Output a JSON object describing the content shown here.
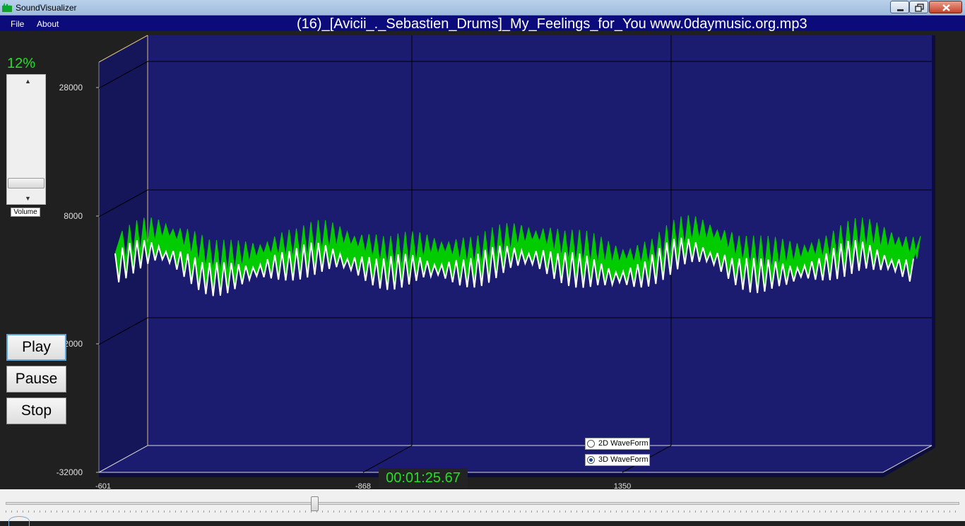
{
  "window": {
    "title": "SoundVisualizer"
  },
  "menu": {
    "file": "File",
    "about": "About"
  },
  "now_playing": "(16)_[Avicii_._Sebastien_Drums]_My_Feelings_for_You www.0daymusic.org.mp3",
  "volume": {
    "percent_text": "12%",
    "level": 0.12,
    "label": "Volume"
  },
  "controls": {
    "play": "Play",
    "pause": "Pause",
    "stop": "Stop"
  },
  "time": "00:01:25.67",
  "waveform_options": {
    "two_d": "2D WaveForm",
    "three_d": "3D WaveForm",
    "selected": "3D WaveForm"
  },
  "seek": {
    "fraction": 0.32
  },
  "colors": {
    "plot_background": "#1b1b70",
    "wave_fill": "#00cc00",
    "wave_line": "#ffffff",
    "accent_green": "#22e022",
    "menu_bar": "#0b0b7c"
  },
  "chart_data": {
    "type": "area",
    "y_ticks": [
      "28000",
      "8000",
      "2000",
      "-32000"
    ],
    "x_ticks": [
      "-601",
      "-868",
      "1350"
    ],
    "ylim": [
      -32000,
      32000
    ],
    "grid": true
  }
}
